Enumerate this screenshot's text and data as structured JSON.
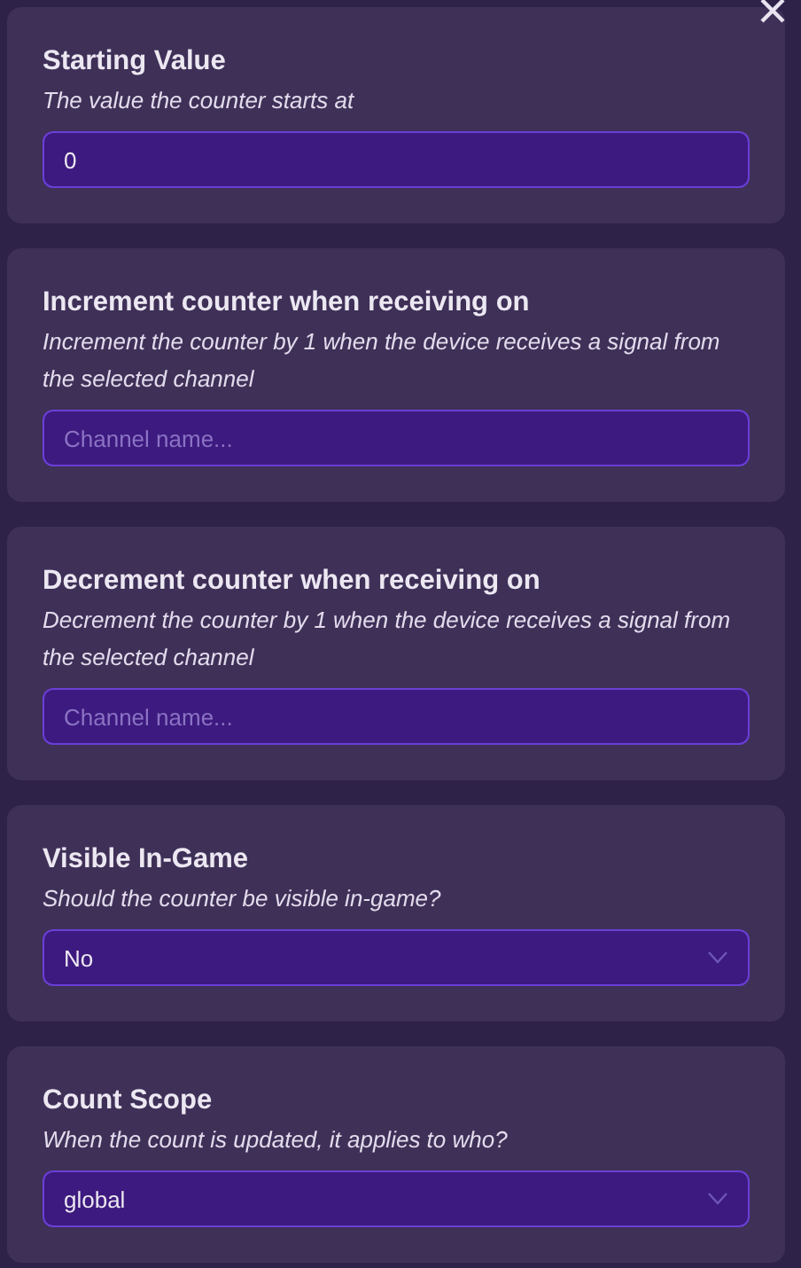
{
  "fields": [
    {
      "kind": "text",
      "title": "Starting Value",
      "description": "The value the counter starts at",
      "value": "0"
    },
    {
      "kind": "text",
      "title": "Increment counter when receiving on",
      "description": "Increment the counter by 1 when the device receives a signal from the selected channel",
      "placeholder": "Channel name..."
    },
    {
      "kind": "text",
      "title": "Decrement counter when receiving on",
      "description": "Decrement the counter by 1 when the device receives a signal from the selected channel",
      "placeholder": "Channel name..."
    },
    {
      "kind": "select",
      "title": "Visible In-Game",
      "description": "Should the counter be visible in-game?",
      "value": "No"
    },
    {
      "kind": "select",
      "title": "Count Scope",
      "description": "When the count is updated, it applies to who?",
      "value": "global"
    }
  ]
}
